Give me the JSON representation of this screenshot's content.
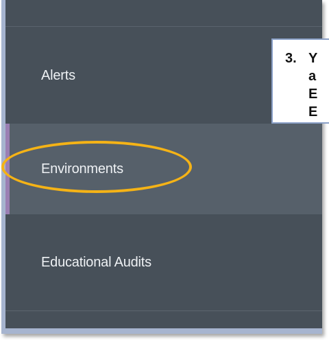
{
  "menu": {
    "items": [
      {
        "label": "Alerts",
        "active": false
      },
      {
        "label": "Environments",
        "active": true
      },
      {
        "label": "Educational Audits",
        "active": false
      }
    ]
  },
  "callout": {
    "step": "3.",
    "lines": [
      "Y",
      "a",
      "E",
      "E"
    ]
  },
  "colors": {
    "sidebar_bg": "#475059",
    "active_bg": "#56606a",
    "active_indicator": "#9b7fb3",
    "highlight": "#f5b316",
    "frame": "#a6b4cf"
  }
}
